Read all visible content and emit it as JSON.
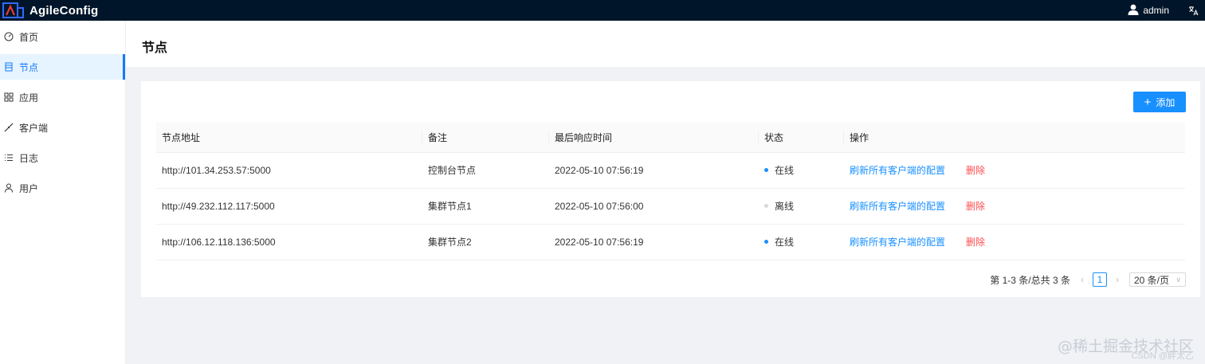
{
  "app": {
    "title": "AgileConfig",
    "user": "admin",
    "brand_color": "#001529",
    "accent": "#1890ff"
  },
  "sidebar": {
    "items": [
      {
        "label": "首页",
        "icon": "dashboard-icon"
      },
      {
        "label": "节点",
        "icon": "node-icon",
        "active": true
      },
      {
        "label": "应用",
        "icon": "apps-icon"
      },
      {
        "label": "客户端",
        "icon": "client-icon"
      },
      {
        "label": "日志",
        "icon": "log-icon"
      },
      {
        "label": "用户",
        "icon": "user-icon"
      }
    ]
  },
  "page": {
    "title": "节点",
    "add_button": "添加"
  },
  "table": {
    "headers": [
      "节点地址",
      "备注",
      "最后响应时间",
      "状态",
      "操作"
    ],
    "rows": [
      {
        "address": "http://101.34.253.57:5000",
        "remark": "控制台节点",
        "last_response": "2022-05-10 07:56:19",
        "status": "在线",
        "status_color": "#1890ff",
        "action": "刷新所有客户端的配置",
        "delete": "删除"
      },
      {
        "address": "http://49.232.112.117:5000",
        "remark": "集群节点1",
        "last_response": "2022-05-10 07:56:00",
        "status": "离线",
        "status_color": "#d9d9d9",
        "action": "刷新所有客户端的配置",
        "delete": "删除"
      },
      {
        "address": "http://106.12.118.136:5000",
        "remark": "集群节点2",
        "last_response": "2022-05-10 07:56:19",
        "status": "在线",
        "status_color": "#1890ff",
        "action": "刷新所有客户端的配置",
        "delete": "删除"
      }
    ]
  },
  "pagination": {
    "total_text": "第 1-3 条/总共 3 条",
    "prev": "‹",
    "current": "1",
    "next": "›",
    "page_size": "20 条/页"
  },
  "watermark": {
    "main": "@稀土掘金技术社区",
    "sub": "CSDN @胖太乙"
  }
}
